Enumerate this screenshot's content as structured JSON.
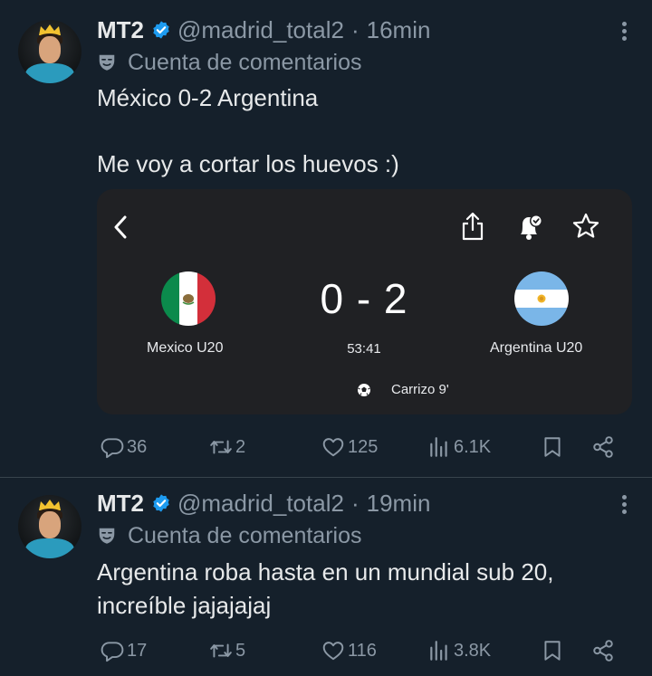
{
  "tweets": [
    {
      "name": "MT2",
      "handle": "@madrid_total2",
      "separator": "·",
      "time": "16min",
      "label": "Cuenta de comentarios",
      "text_lines": [
        "México 0-2 Argentina",
        "Me voy a cortar los huevos :)"
      ],
      "card": {
        "home_team": "Mexico U20",
        "away_team": "Argentina U20",
        "score": "0 - 2",
        "clock": "53:41",
        "scorer": "Carrizo 9'"
      },
      "replies": "36",
      "retweets": "2",
      "likes": "125",
      "views": "6.1K"
    },
    {
      "name": "MT2",
      "handle": "@madrid_total2",
      "separator": "·",
      "time": "19min",
      "label": "Cuenta de comentarios",
      "text": "Argentina roba hasta en un mundial sub 20, increíble jajajajaj",
      "replies": "17",
      "retweets": "5",
      "likes": "116",
      "views": "3.8K"
    }
  ],
  "icons": {
    "verified": "verified-badge-icon",
    "label": "theater-masks-icon",
    "reply": "reply-icon",
    "retweet": "retweet-icon",
    "like": "heart-icon",
    "views": "views-chart-icon",
    "bookmark": "bookmark-icon",
    "share": "share-icon"
  },
  "colors": {
    "background": "#15202b",
    "text": "#e7e9ea",
    "secondary_text": "#8b98a5",
    "verified_blue": "#1d9bf0",
    "card_background": "#202124",
    "divider": "#38444d"
  }
}
